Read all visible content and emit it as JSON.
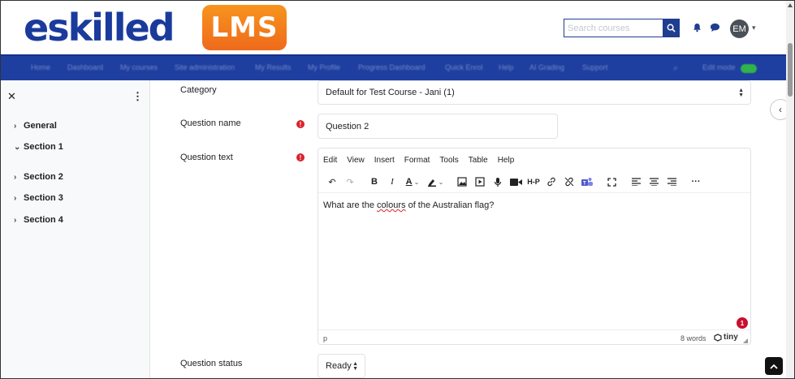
{
  "header": {
    "logo_text": "eskilled",
    "logo_badge": "LMS",
    "search_placeholder": "Search courses",
    "avatar_initials": "EM"
  },
  "nav": {
    "items": [
      "Home",
      "Dashboard",
      "My courses",
      "Site administration",
      "My Results",
      "My Profile",
      "Progress Dashboard",
      "Quick Enrol",
      "Help",
      "AI Grading",
      "Support"
    ],
    "edit_mode_label": "Edit mode"
  },
  "drawer": {
    "items": [
      {
        "label": "General",
        "expanded": false
      },
      {
        "label": "Section 1",
        "expanded": true
      },
      {
        "label": "Section 2",
        "expanded": false
      },
      {
        "label": "Section 3",
        "expanded": false
      },
      {
        "label": "Section 4",
        "expanded": false
      }
    ]
  },
  "form": {
    "category_label": "Category",
    "category_value": "Default for Test Course - Jani (1)",
    "name_label": "Question name",
    "name_value": "Question 2",
    "text_label": "Question text",
    "status_label": "Question status",
    "status_value": "Ready",
    "required_icon": "!"
  },
  "editor": {
    "menus": [
      "Edit",
      "View",
      "Insert",
      "Format",
      "Tools",
      "Table",
      "Help"
    ],
    "content_before": "What are the ",
    "content_misspelled": "colours",
    "content_after": " of the Australian flag?",
    "status_path": "p",
    "word_count": "8 words",
    "brand": "tiny",
    "notification_count": "1"
  },
  "colors": {
    "brand_blue": "#1f3fa0",
    "logo_orange": "#f7941d",
    "required_red": "#d9232d"
  }
}
